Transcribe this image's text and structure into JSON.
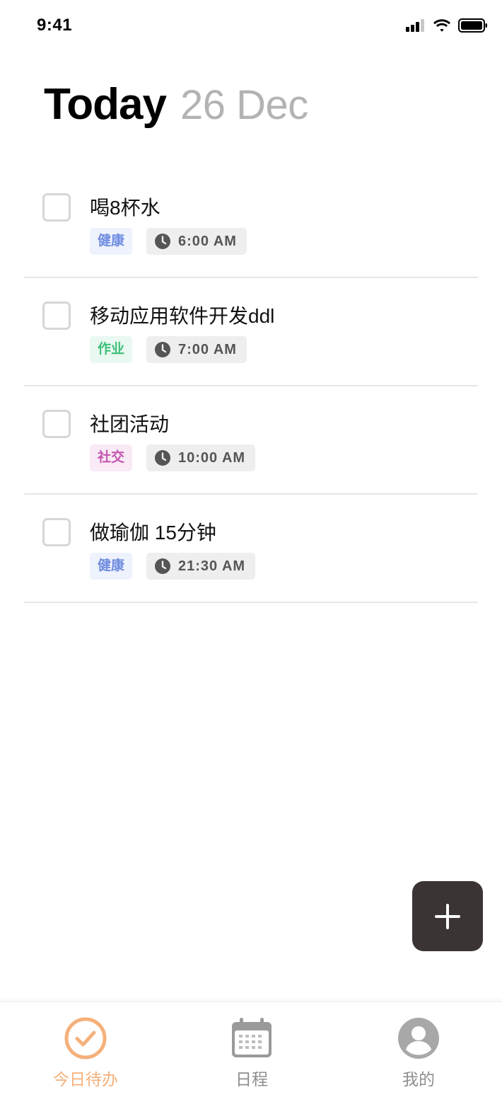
{
  "status_bar": {
    "time": "9:41"
  },
  "header": {
    "title": "Today",
    "date": "26 Dec"
  },
  "tasks": [
    {
      "title": "喝8杯水",
      "tag": "健康",
      "tag_color": "#6f8ce0",
      "tag_bg": "#eef2fc",
      "time": "6:00 AM",
      "completed": false
    },
    {
      "title": "移动应用软件开发ddl",
      "tag": "作业",
      "tag_color": "#3ec07a",
      "tag_bg": "#e9f8f0",
      "time": "7:00 AM",
      "completed": false
    },
    {
      "title": "社团活动",
      "tag": "社交",
      "tag_color": "#c457b0",
      "tag_bg": "#f9eaf6",
      "time": "10:00 AM",
      "completed": false
    },
    {
      "title": "做瑜伽 15分钟",
      "tag": "健康",
      "tag_color": "#6f8ce0",
      "tag_bg": "#eef2fc",
      "time": "21:30 AM",
      "completed": false
    }
  ],
  "fab": {
    "icon": "plus-icon",
    "color": "#3b3434"
  },
  "tab_bar": {
    "items": [
      {
        "label": "今日待办",
        "icon": "check-circle-icon",
        "active": true,
        "color": "#f5b07a"
      },
      {
        "label": "日程",
        "icon": "calendar-icon",
        "active": false,
        "color": "#8e8e8e"
      },
      {
        "label": "我的",
        "icon": "user-icon",
        "active": false,
        "color": "#8e8e8e"
      }
    ]
  }
}
